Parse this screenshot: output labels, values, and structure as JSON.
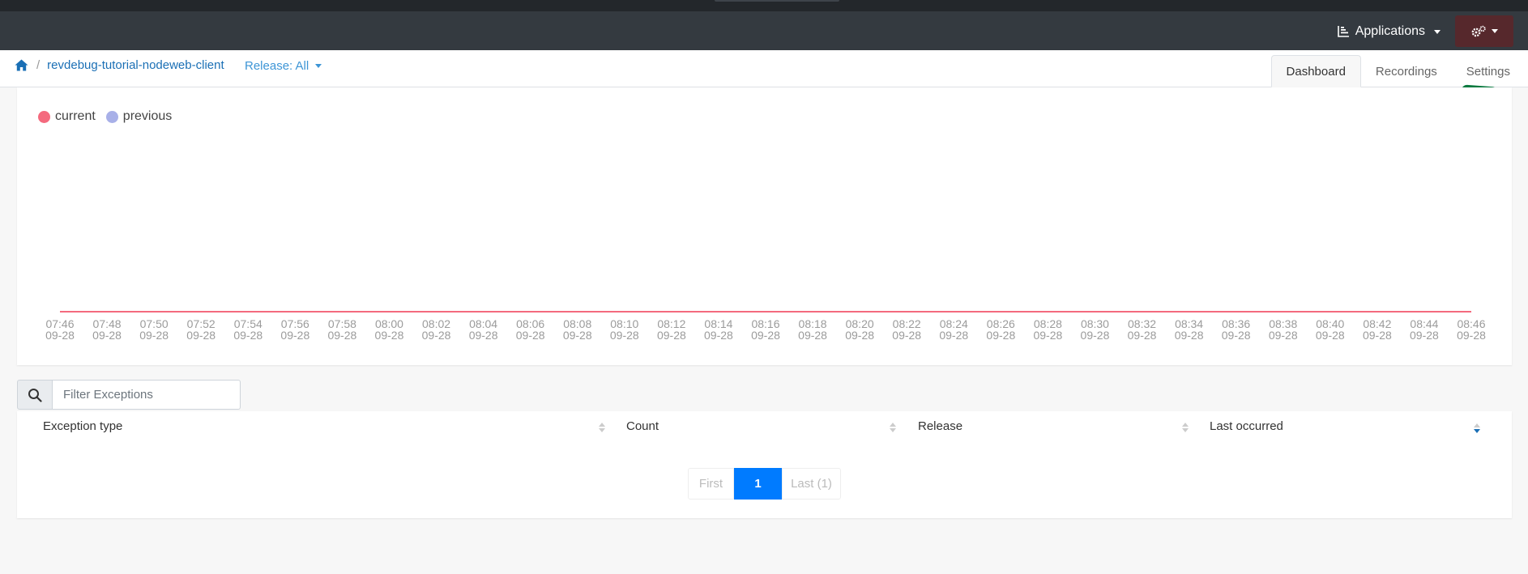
{
  "navbar": {
    "applications_label": "Applications"
  },
  "breadcrumb": {
    "separator": "/",
    "app_name": "revdebug-tutorial-nodeweb-client"
  },
  "release": {
    "label": "Release: All"
  },
  "tabs": [
    {
      "label": "Dashboard",
      "active": true
    },
    {
      "label": "Recordings",
      "active": false
    },
    {
      "label": "Settings",
      "active": false
    }
  ],
  "colors": {
    "current": "#f46a7e",
    "previous": "#a8b0e8",
    "accent": "#007bff",
    "navbar": "#343a40",
    "gear_button": "#56282c"
  },
  "chart_data": {
    "type": "line",
    "legend": [
      {
        "name": "current",
        "color": "#f46a7e"
      },
      {
        "name": "previous",
        "color": "#a8b0e8"
      }
    ],
    "x": [
      "07:46",
      "07:48",
      "07:50",
      "07:52",
      "07:54",
      "07:56",
      "07:58",
      "08:00",
      "08:02",
      "08:04",
      "08:06",
      "08:08",
      "08:10",
      "08:12",
      "08:14",
      "08:16",
      "08:18",
      "08:20",
      "08:22",
      "08:24",
      "08:26",
      "08:28",
      "08:30",
      "08:32",
      "08:34",
      "08:36",
      "08:38",
      "08:40",
      "08:42",
      "08:44",
      "08:46"
    ],
    "x_date": "09-28",
    "series": [
      {
        "name": "current",
        "values": [
          0,
          0,
          0,
          0,
          0,
          0,
          0,
          0,
          0,
          0,
          0,
          0,
          0,
          0,
          0,
          0,
          0,
          0,
          0,
          0,
          0,
          0,
          0,
          0,
          0,
          0,
          0,
          0,
          0,
          0,
          0
        ]
      },
      {
        "name": "previous",
        "values": [
          0,
          0,
          0,
          0,
          0,
          0,
          0,
          0,
          0,
          0,
          0,
          0,
          0,
          0,
          0,
          0,
          0,
          0,
          0,
          0,
          0,
          0,
          0,
          0,
          0,
          0,
          0,
          0,
          0,
          0,
          0
        ]
      }
    ],
    "legend_position": "top-left",
    "grid": false
  },
  "filter": {
    "placeholder": "Filter Exceptions",
    "value": ""
  },
  "table": {
    "columns": [
      "Exception type",
      "Count",
      "Release",
      "Last occurred"
    ],
    "sorted_column": "Last occurred",
    "rows": []
  },
  "pagination": {
    "first_label": "First",
    "current_page": "1",
    "last_label": "Last (1)"
  }
}
